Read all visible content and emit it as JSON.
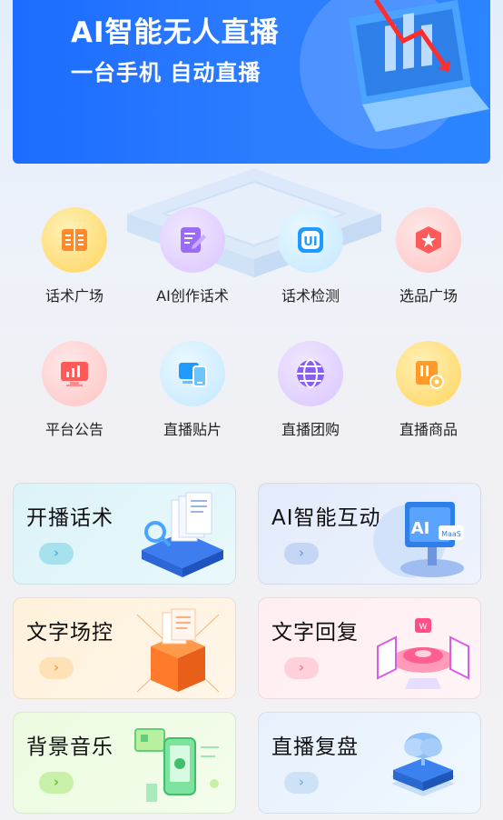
{
  "banner": {
    "title": "AI智能无人直播",
    "subtitle": "一台手机 自动直播"
  },
  "grid": [
    {
      "label": "话术广场",
      "icon": "book-icon",
      "bg": "#ffe08a",
      "color": "#ff8a2b"
    },
    {
      "label": "AI创作话术",
      "icon": "edit-icon",
      "bg": "#e2d3ff",
      "color": "#8b5cf6"
    },
    {
      "label": "话术检测",
      "icon": "ui-check-icon",
      "bg": "#cdeeff",
      "color": "#1f9bff"
    },
    {
      "label": "选品广场",
      "icon": "shield-star-icon",
      "bg": "#ffd3d3",
      "color": "#ff5a5a"
    },
    {
      "label": "平台公告",
      "icon": "monitor-chart-icon",
      "bg": "#ffd3d3",
      "color": "#ff5a5a"
    },
    {
      "label": "直播贴片",
      "icon": "devices-icon",
      "bg": "#cdeeff",
      "color": "#1f9bff"
    },
    {
      "label": "直播团购",
      "icon": "globe-icon",
      "bg": "#e2d3ff",
      "color": "#8b5cf6"
    },
    {
      "label": "直播商品",
      "icon": "product-box-icon",
      "bg": "#ffe08a",
      "color": "#ff8a2b"
    }
  ],
  "cards": [
    {
      "title": "开播话术",
      "bg": "#dff3f8",
      "btn": "#a8e1ee",
      "arrow": "#4fb9d8",
      "icon": "document-stack-icon"
    },
    {
      "title": "AI智能互动",
      "bg": "#e4ecfb",
      "btn": "#c5d6f5",
      "arrow": "#7a9edf",
      "icon": "ai-maas-icon"
    },
    {
      "title": "文字场控",
      "bg": "#fff3e0",
      "btn": "#ffe1b8",
      "arrow": "#f2a64a",
      "icon": "box-control-icon"
    },
    {
      "title": "文字回复",
      "bg": "#ffeef1",
      "btn": "#ffd0da",
      "arrow": "#f27b97",
      "icon": "reply-screens-icon"
    },
    {
      "title": "背景音乐",
      "bg": "#effbe4",
      "btn": "#c9f0a8",
      "arrow": "#63c534",
      "icon": "music-phone-icon"
    },
    {
      "title": "直播复盘",
      "bg": "#e8f2fd",
      "btn": "#cde1f7",
      "arrow": "#7ab0e3",
      "icon": "cloud-stack-icon"
    }
  ]
}
